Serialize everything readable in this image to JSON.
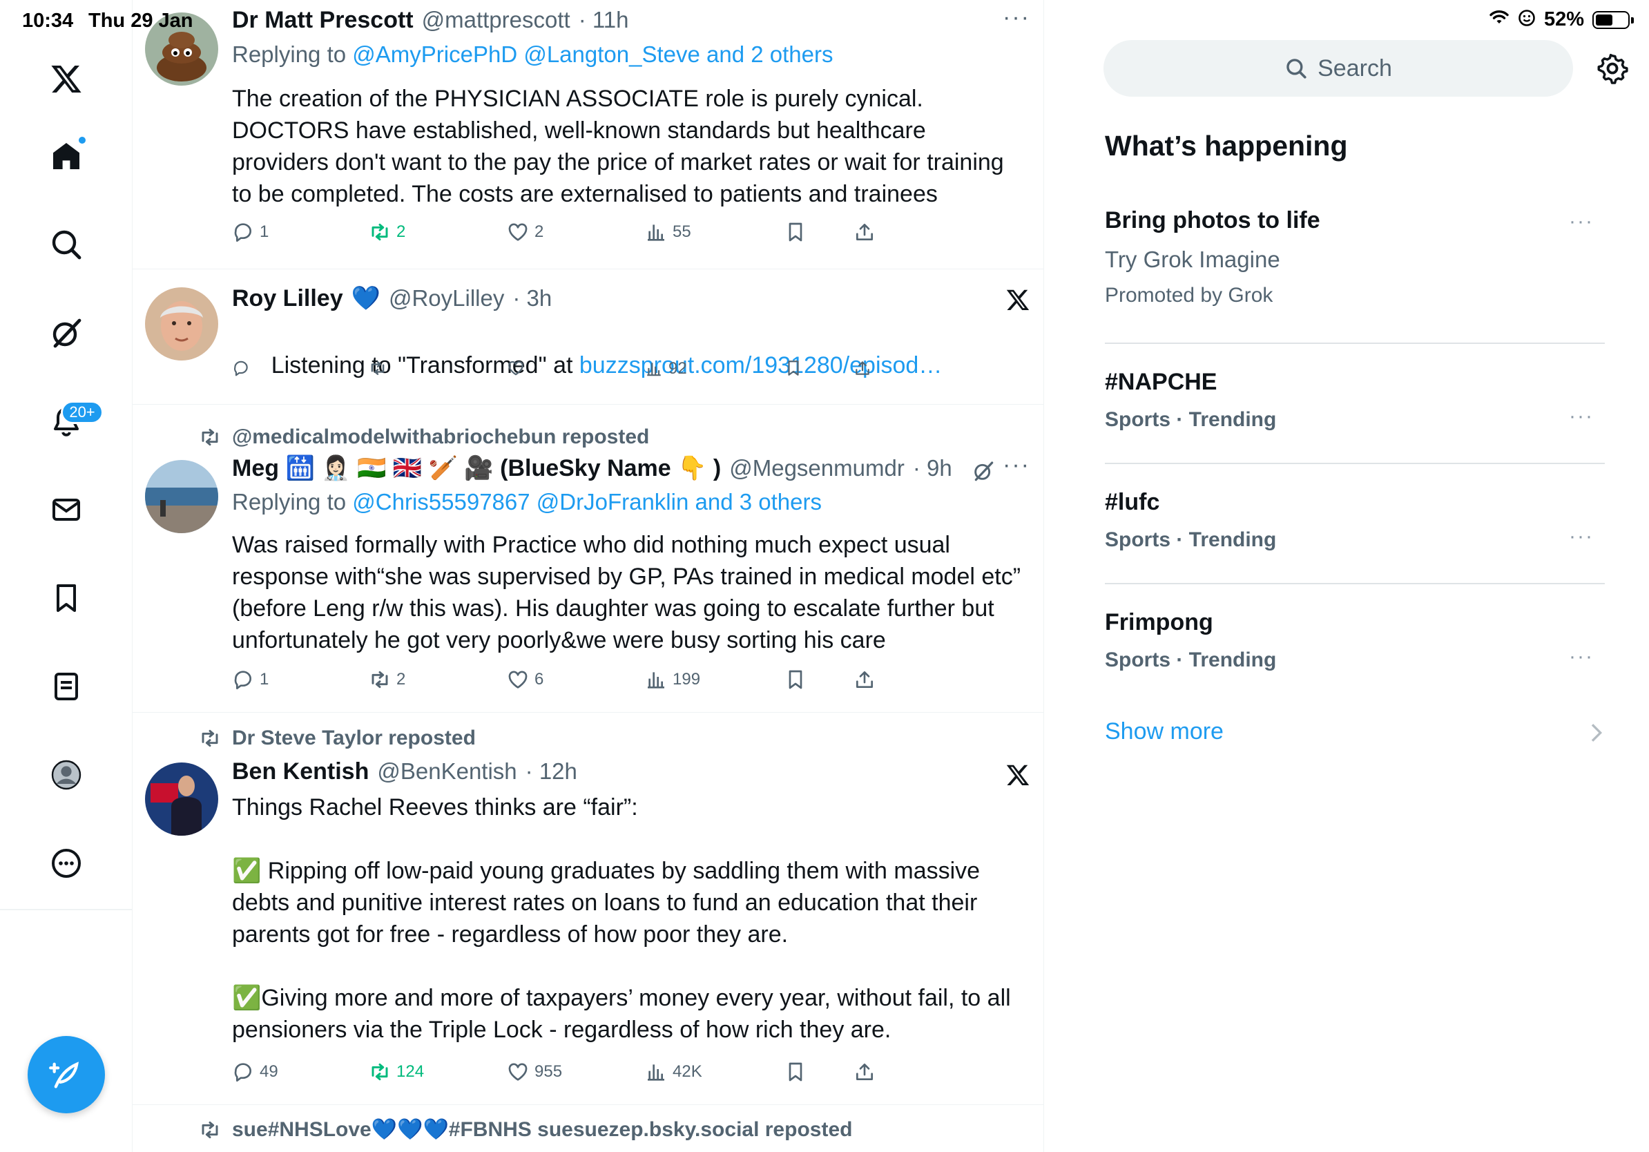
{
  "status_bar": {
    "time": "10:34",
    "date": "Thu 29 Jan",
    "battery": "52%",
    "battery_level": 0.52
  },
  "nav": {
    "notifications_count": "20+"
  },
  "tweets": [
    {
      "name": "Dr Matt Prescott",
      "handle": "@mattprescott",
      "time": "· 11h",
      "reply_prefix": "Replying to",
      "reply_to": "@AmyPricePhD @Langton_Steve and 2 others",
      "text": "The creation of the PHYSICIAN ASSOCIATE role is purely cynical. DOCTORS have established, well-known standards but healthcare providers don't want to the pay the price of market rates or wait for training to be completed. The costs are externalised to patients and trainees",
      "replies": "1",
      "reposts": "2",
      "likes": "2",
      "views": "55"
    },
    {
      "name": "Roy Lilley",
      "name_emoji": "💙",
      "handle": "@RoyLilley",
      "time": "· 3h",
      "text": "Listening to \"Transformed\" at ",
      "link": "buzzsprout.com/1931280/episod…",
      "replies": "",
      "reposts": "",
      "likes": "",
      "views": "92"
    },
    {
      "repost_by": "@medicalmodelwithabriochebun reposted",
      "name": "Meg 🛗 👩🏻‍⚕️ 🇮🇳 🇬🇧 🏏 🎥 (BlueSky Name 👇 )",
      "handle": "@Megsenmumdr",
      "time": "· 9h",
      "reply_prefix": "Replying to",
      "reply_to": "@Chris55597867 @DrJoFranklin and 3 others",
      "text": "Was raised formally with Practice who did nothing much expect usual response with“she was supervised by GP, PAs trained in medical model etc” (before Leng r/w this was). His daughter was going to escalate further but unfortunately he got very poorly&we were busy sorting his care",
      "replies": "1",
      "reposts": "2",
      "likes": "6",
      "views": "199"
    },
    {
      "repost_by": "Dr Steve Taylor reposted",
      "name": "Ben Kentish",
      "handle": "@BenKentish",
      "time": "· 12h",
      "text": "Things Rachel Reeves thinks are “fair”:\n\n✅ Ripping off low-paid young graduates by saddling them with massive debts and punitive interest rates on loans to fund an education that their parents got for free - regardless of how poor they are.\n\n✅Giving more and more of taxpayers’ money every year, without fail, to all pensioners via the Triple Lock - regardless of how rich they are.",
      "replies": "49",
      "reposts": "124",
      "likes": "955",
      "views": "42K"
    },
    {
      "repost_by": "sue#NHSLove💙💙💙#FBNHS suesuezep.bsky.social reposted"
    }
  ],
  "sidebar": {
    "search_placeholder": "Search",
    "heading": "What’s happening",
    "promo": {
      "title": "Bring photos to life",
      "subtitle": "Try Grok Imagine",
      "promoted": "Promoted by Grok"
    },
    "trends": [
      {
        "title": "#NAPCHE",
        "meta": "Sports · Trending"
      },
      {
        "title": "#lufc",
        "meta": "Sports · Trending"
      },
      {
        "title": "Frimpong",
        "meta": "Sports · Trending"
      }
    ],
    "show_more": "Show more"
  },
  "colors": {
    "accent": "#1d9bf0",
    "repost_green": "#00ba7c",
    "secondary_text": "#536471"
  }
}
